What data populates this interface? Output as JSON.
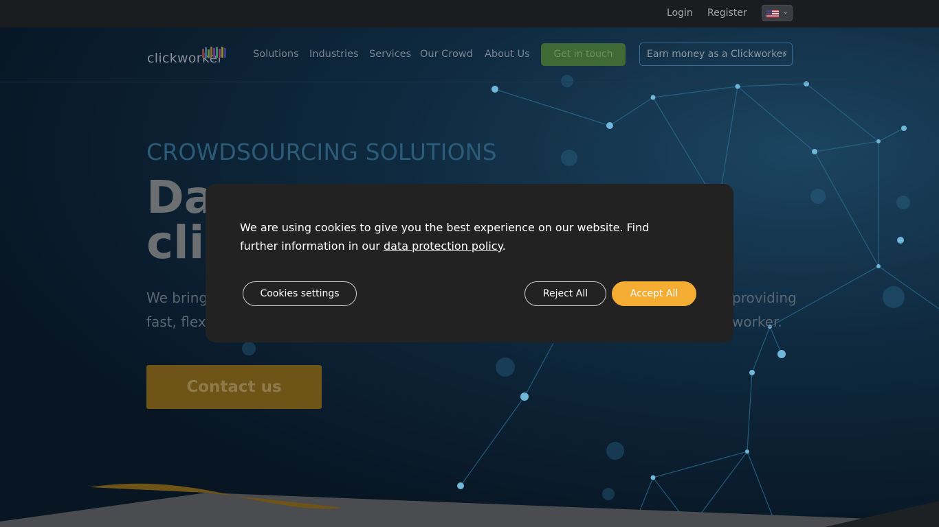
{
  "topbar": {
    "login": "Login",
    "register": "Register",
    "language_flag": "us-flag-icon"
  },
  "nav": {
    "logo_text": "clickworker",
    "items": [
      "Solutions",
      "Industries",
      "Services",
      "Our Crowd",
      "About Us"
    ],
    "get_in_touch": "Get in touch",
    "earn_money": "Earn money as a Clickworker"
  },
  "hero": {
    "eyebrow": "CROWDSOURCING SOLUTIONS",
    "headline_line1": "Da",
    "headline_line2": "cli",
    "lead_left_1": "We bring",
    "lead_right_1": "providing",
    "lead_left_2": "fast, flexib",
    "lead_right_2": "worker.",
    "cta": "Contact us"
  },
  "cookie_modal": {
    "text": "We are using cookies to give you the best experience on our website. Find further information in our",
    "link": "data protection policy",
    "period": ".",
    "settings": "Cookies settings",
    "reject": "Reject All",
    "accept": "Accept All"
  },
  "colors": {
    "accept": "#f5ac33",
    "green_button": "#3e6a36",
    "eyebrow": "#2c5b78",
    "cta": "#6f5418"
  }
}
